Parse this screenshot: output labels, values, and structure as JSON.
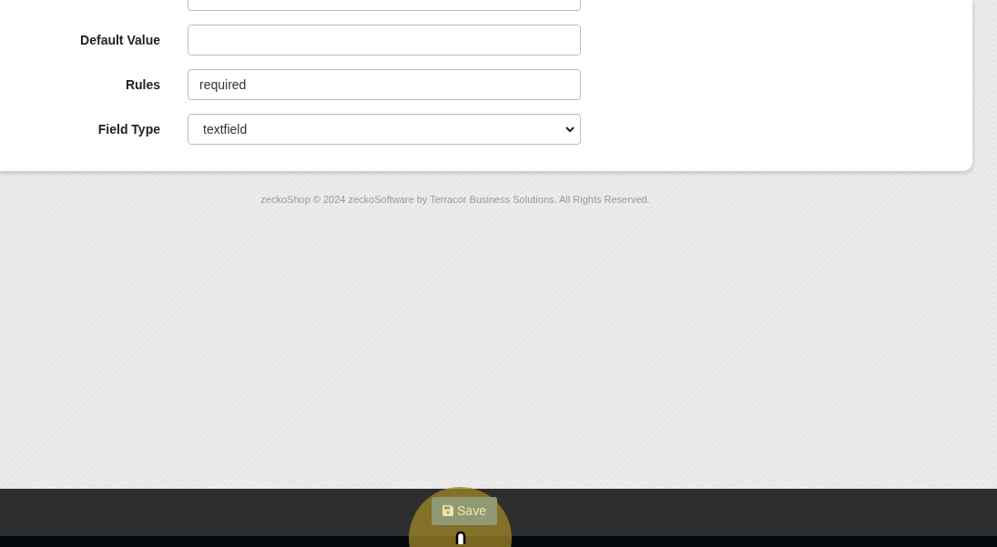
{
  "form": {
    "fields": [
      {
        "kind": "text",
        "label": "Default Value"
      },
      {
        "kind": "text",
        "label": "Rules",
        "value": "required"
      },
      {
        "kind": "select",
        "label": "Field Type",
        "value": "textfield"
      }
    ]
  },
  "footer": {
    "text": "zeckoShop © 2024 zeckoSoftware by Terracor Business Solutions. All Rights Reserved."
  },
  "action_bar": {
    "save_label": "Save"
  }
}
